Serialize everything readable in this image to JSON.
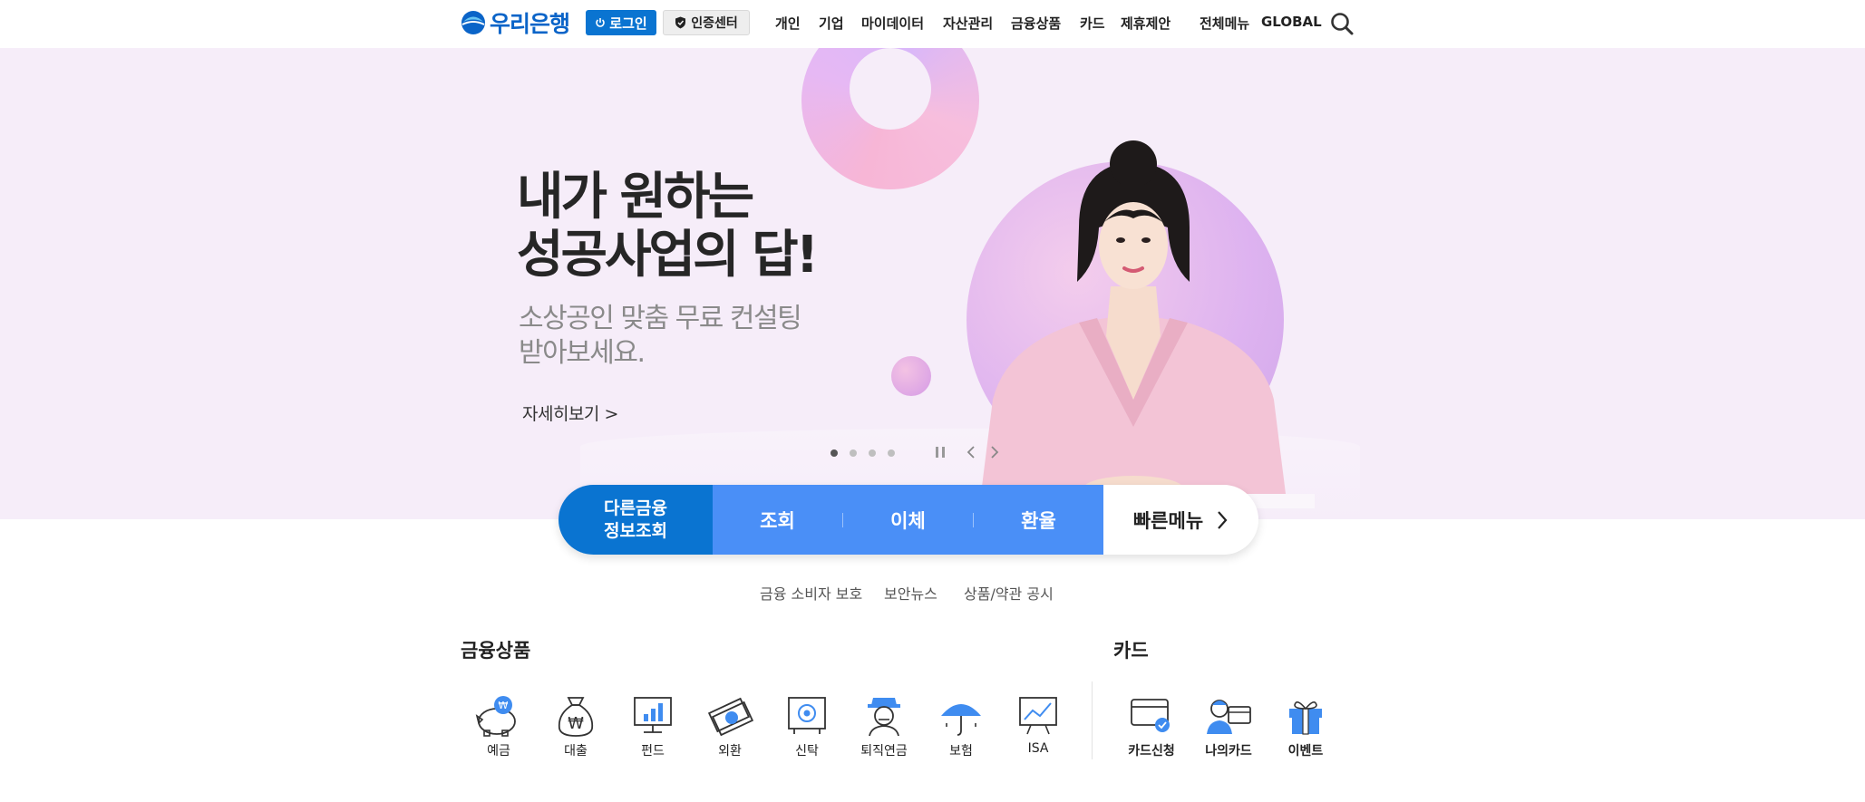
{
  "header": {
    "logo_text": "우리은행",
    "login_label": "로그인",
    "cert_label": "인증센터",
    "nav": [
      "개인",
      "기업",
      "마이데이터",
      "자산관리",
      "금융상품",
      "카드",
      "제휴제안"
    ],
    "all_menu": "전체메뉴",
    "global": "GLOBAL"
  },
  "hero": {
    "title_line1": "내가 원하는",
    "title_line2": "성공사업의 답!",
    "sub_line1": "소상공인 맞춤 무료 컨설팅",
    "sub_line2": "받아보세요.",
    "more": "자세히보기 >",
    "slide_count": 4,
    "active_slide": 1
  },
  "quickbar": {
    "other_line1": "다른금융",
    "other_line2": "정보조회",
    "items": [
      "조회",
      "이체",
      "환율"
    ],
    "quick_menu": "빠른메뉴"
  },
  "links": [
    "금융 소비자 보호",
    "보안뉴스",
    "상품/약관 공시"
  ],
  "products": {
    "title": "금융상품",
    "items": [
      "예금",
      "대출",
      "펀드",
      "외환",
      "신탁",
      "퇴직연금",
      "보험",
      "ISA"
    ]
  },
  "cards": {
    "title": "카드",
    "items": [
      "카드신청",
      "나의카드",
      "이벤트"
    ]
  },
  "colors": {
    "brand_blue": "#0a74d1",
    "quick_blue": "#4a8ff7",
    "hero_bg": "#f6edf9"
  }
}
